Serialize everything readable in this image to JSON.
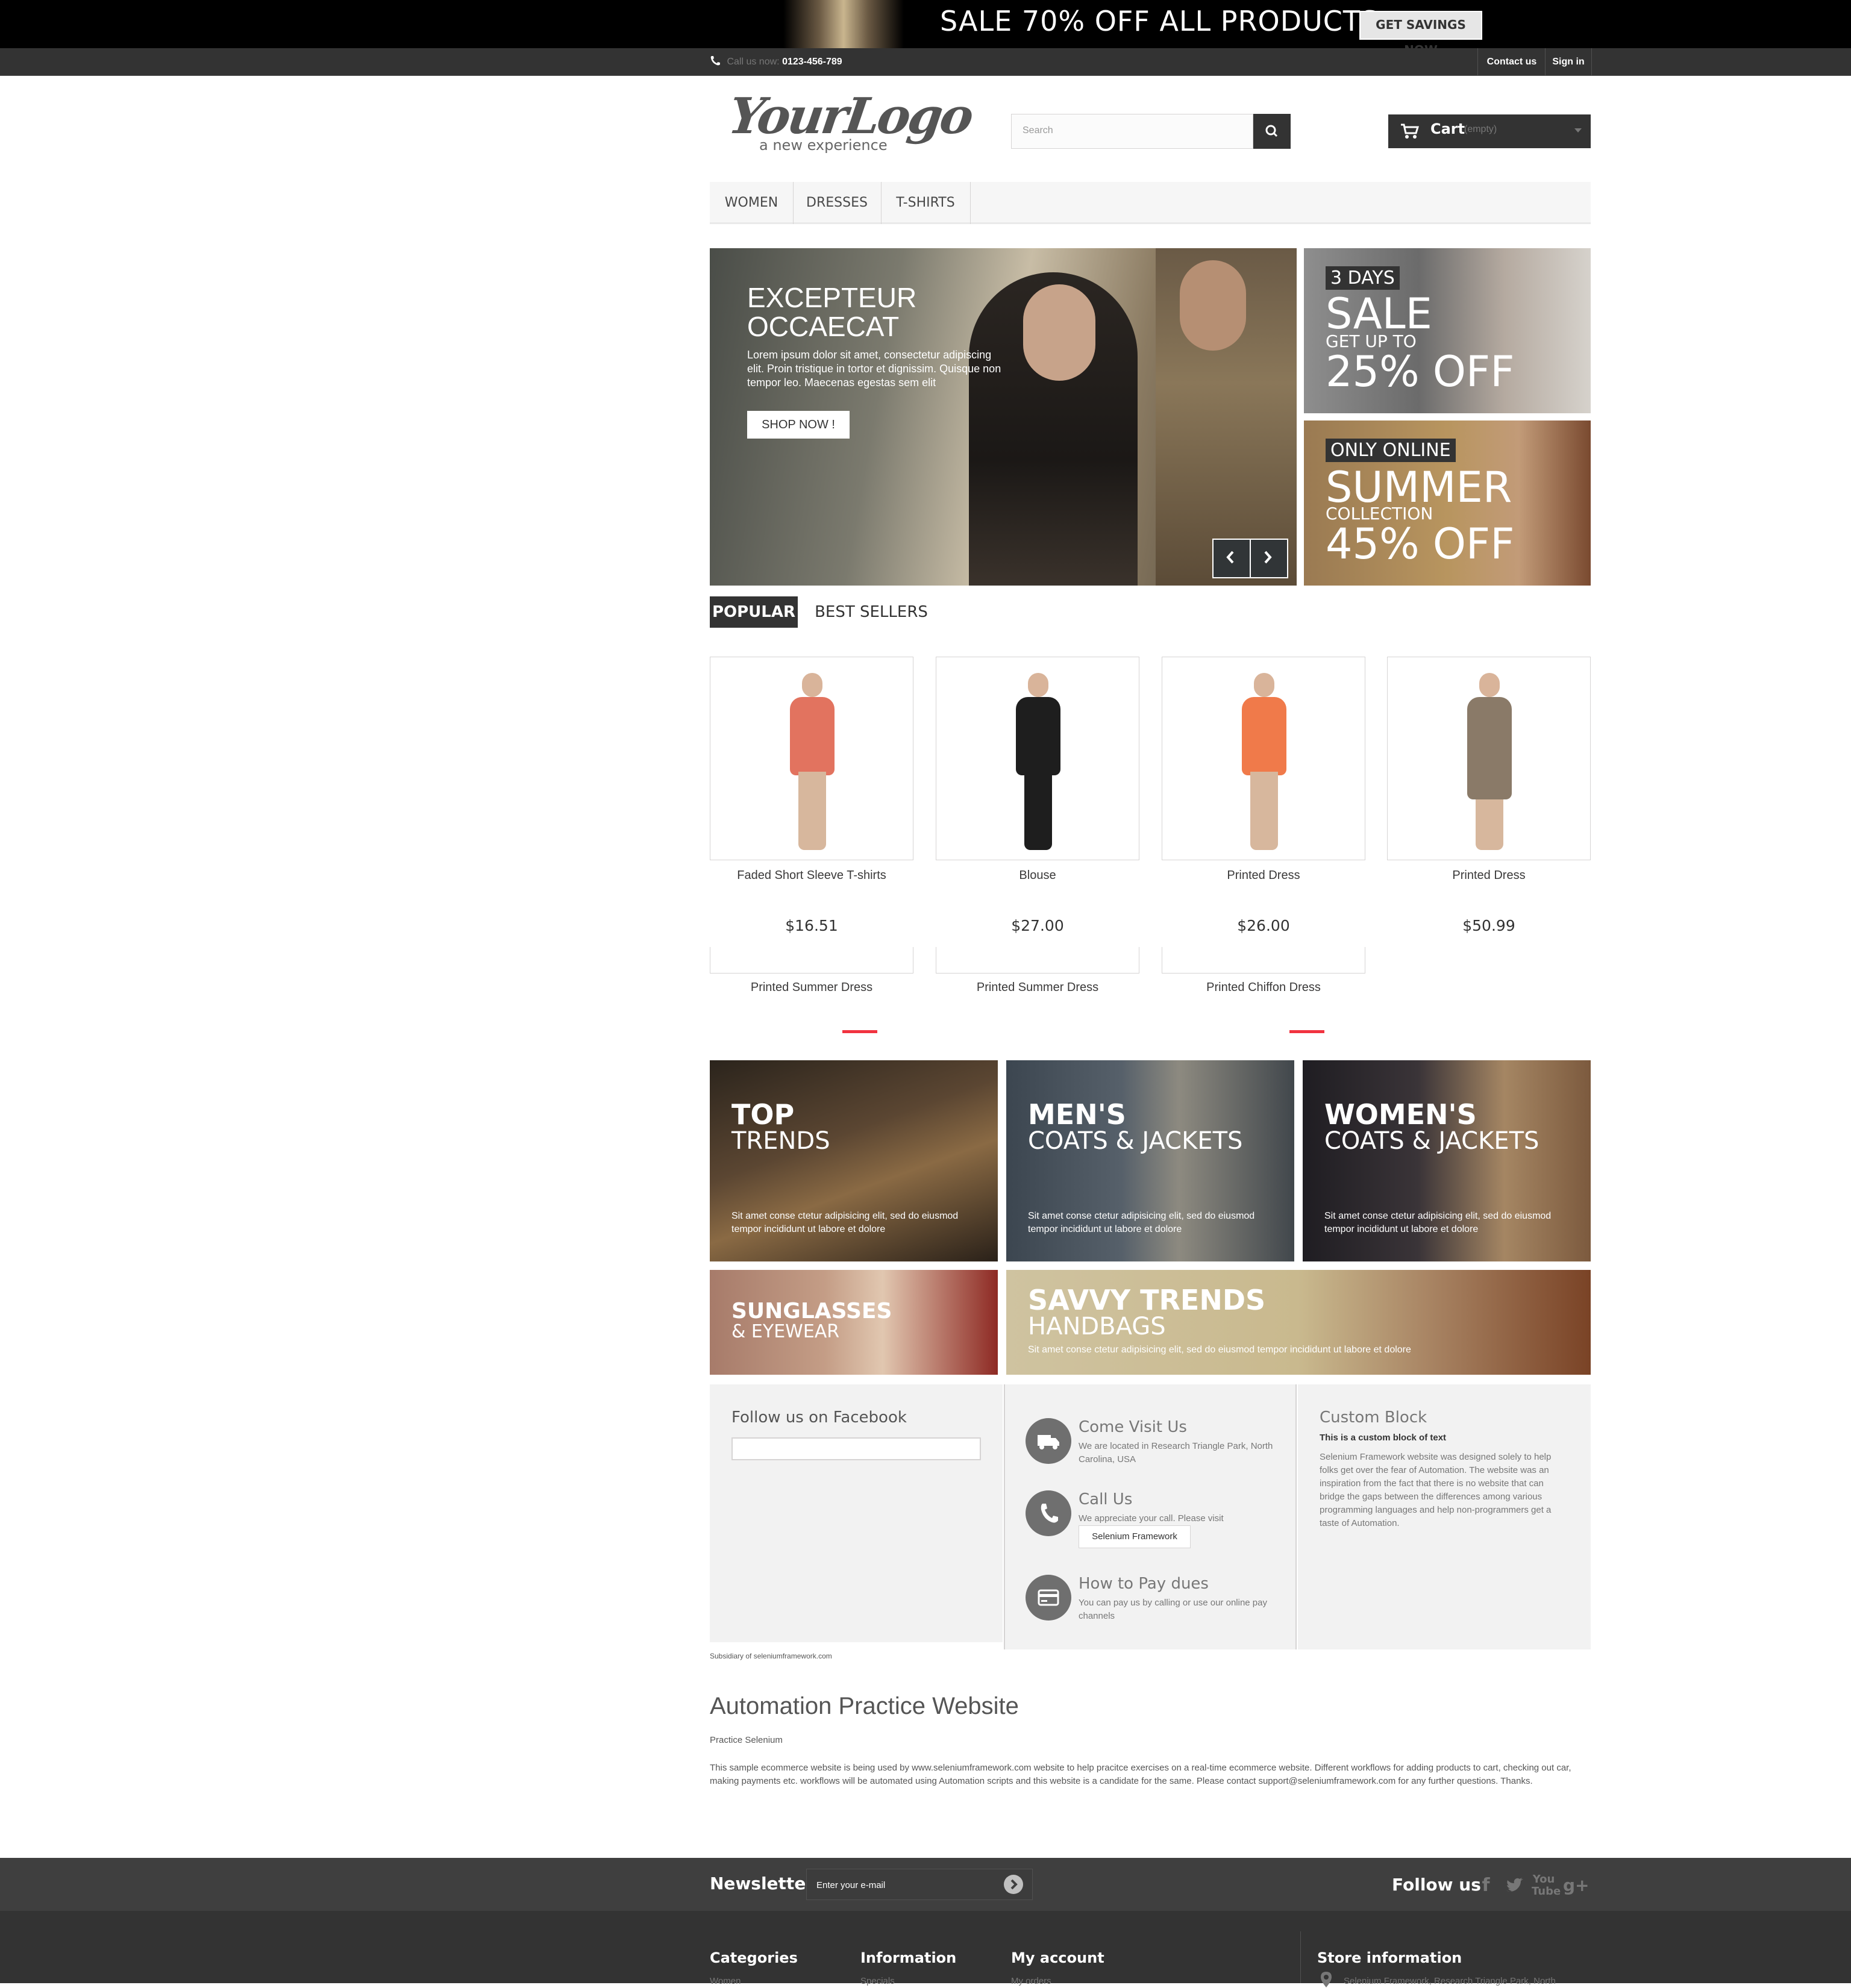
{
  "banner": {
    "sale_text": "SALE 70% OFF ALL PRODUCTS",
    "button": "GET SAVINGS NOW"
  },
  "nav": {
    "call_label": "Call us now:",
    "phone": "0123-456-789",
    "contact": "Contact us",
    "signin": "Sign in"
  },
  "header": {
    "logo_main": "YourLogo",
    "logo_tagline": "a new experience",
    "search_placeholder": "Search",
    "cart_label": "Cart",
    "cart_status": "(empty)"
  },
  "menu": [
    "WOMEN",
    "DRESSES",
    "T-SHIRTS"
  ],
  "slider": {
    "title": "EXCEPTEUR OCCAECAT",
    "text": "Lorem ipsum dolor sit amet, consectetur adipiscing elit. Proin tristique in tortor et dignissim. Quisque non tempor leo. Maecenas egestas sem elit",
    "button": "SHOP NOW !"
  },
  "side_banners": [
    {
      "tag": "3 DAYS",
      "big": "SALE",
      "mid": "GET UP TO",
      "pct": "25% OFF"
    },
    {
      "tag": "ONLY ONLINE",
      "big": "SUMMER",
      "mid": "COLLECTION",
      "pct": "45% OFF"
    }
  ],
  "tabs": {
    "popular": "POPULAR",
    "best": "BEST SELLERS"
  },
  "products": [
    {
      "name": "Faded Short Sleeve T-shirts",
      "price": "$16.51",
      "color": "#e2735f"
    },
    {
      "name": "Blouse",
      "price": "$27.00",
      "color": "#1e1e1e"
    },
    {
      "name": "Printed Dress",
      "price": "$26.00",
      "color": "#f07a4a"
    },
    {
      "name": "Printed Dress",
      "price": "$50.99",
      "color": "#8a7a68"
    }
  ],
  "products_row2": [
    "Printed Summer Dress",
    "Printed Summer Dress",
    "Printed Chiffon Dress"
  ],
  "tiles": [
    {
      "t1": "TOP",
      "t2": "TRENDS",
      "d": "Sit amet conse ctetur adipisicing elit, sed do eiusmod tempor incididunt ut labore et dolore"
    },
    {
      "t1": "MEN'S",
      "t2": "COATS & JACKETS",
      "d": "Sit amet conse ctetur adipisicing elit, sed do eiusmod tempor incididunt ut labore et dolore"
    },
    {
      "t1": "WOMEN'S",
      "t2": "COATS & JACKETS",
      "d": "Sit amet conse ctetur adipisicing elit, sed do eiusmod tempor incididunt ut labore et dolore"
    },
    {
      "t1": "SUNGLASSES",
      "t2": "& EYEWEAR"
    },
    {
      "t1": "SAVVY TRENDS",
      "t2": "HANDBAGS",
      "d": "Sit amet conse ctetur adipisicing elit, sed do eiusmod tempor incididunt ut labore et dolore"
    }
  ],
  "facebook": {
    "title": "Follow us on Facebook"
  },
  "cms": [
    {
      "title": "Come Visit Us",
      "text": "We are located in Research Triangle Park, North Carolina, USA"
    },
    {
      "title": "Call Us",
      "text": "We appreciate your call. Please visit",
      "button": "Selenium Framework"
    },
    {
      "title": "How to Pay dues",
      "text": "You can pay us by calling or use our online pay channels"
    }
  ],
  "custom": {
    "title": "Custom Block",
    "subtitle": "This is a custom block of text",
    "text": "Selenium Framework website was designed solely to help folks get over the fear of Automation. The website was an inspiration from the fact that there is no website that can bridge the gaps between the differences among various programming languages and help non-programmers get a taste of Automation."
  },
  "subsidiary": "Subsidiary of seleniumframework.com",
  "about": {
    "title": "Automation Practice Website",
    "sub": "Practice Selenium",
    "text": "This sample ecommerce website is being used by www.seleniumframework.com website to help pracitce exercises on a real-time ecommerce website. Different workflows for adding products to cart, checking out car, making payments etc. workflows will be automated using Automation scripts and this website is a candidate for the same. Please contact support@seleniumframework.com for any further questions. Thanks."
  },
  "newsletter": {
    "label": "Newsletter",
    "placeholder": "Enter your e-mail",
    "follow": "Follow us"
  },
  "footer": {
    "categories": {
      "h": "Categories",
      "first": "Women"
    },
    "information": {
      "h": "Information",
      "first": "Specials"
    },
    "account": {
      "h": "My account",
      "first": "My orders"
    },
    "store": {
      "h": "Store information",
      "first": "Selenium Framework, Research Triangle Park, North"
    }
  }
}
